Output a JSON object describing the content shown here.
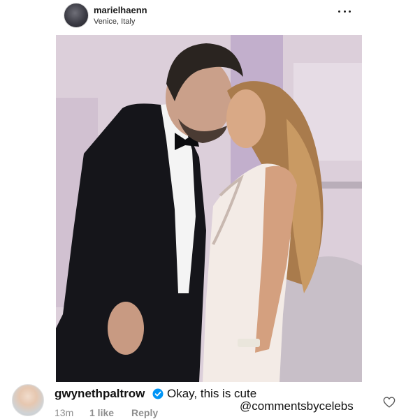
{
  "post": {
    "username": "marielhaenn",
    "location": "Venice, Italy",
    "more_icon": "more-horizontal-icon",
    "photo": "couple-kissing-red-carpet-photo"
  },
  "comment": {
    "username": "gwynethpaltrow",
    "verified_icon": "verified-badge-icon",
    "text": "Okay, this is cute",
    "time": "13m",
    "likes": "1 like",
    "reply_label": "Reply",
    "like_icon": "heart-outline-icon"
  },
  "watermark": "@commentsbycelebs",
  "colors": {
    "verified_blue": "#0095f6",
    "meta_gray": "#8e8e8e",
    "backdrop_lavender": "#d9ccd8"
  }
}
